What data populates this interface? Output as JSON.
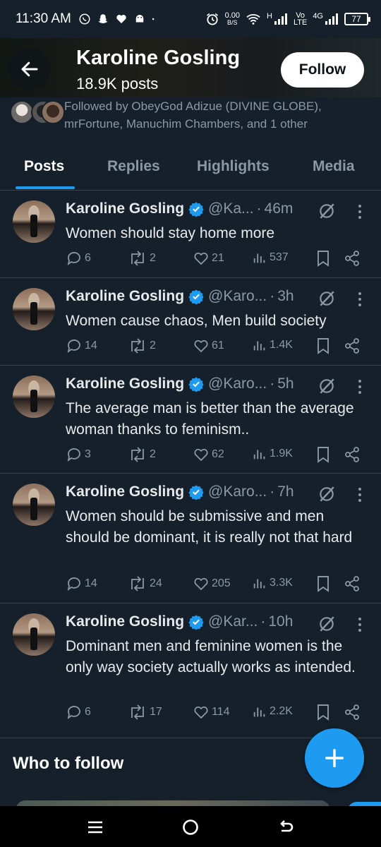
{
  "status_bar": {
    "time": "11:30 AM",
    "net_speed_value": "0.00",
    "net_speed_unit": "B/S",
    "signal1_label": "H",
    "volte_top": "Vo",
    "volte_bottom": "LTE",
    "signal2_label": "4G",
    "battery": "77"
  },
  "header": {
    "title": "Karoline Gosling",
    "posts_count": "18.9K posts",
    "follow_label": "Follow"
  },
  "followed_by": "Followed by ObeyGod Adizue (DIVINE GLOBE), mrFortune, Manuchim Chambers, and 1 other",
  "tabs": [
    "Posts",
    "Replies",
    "Highlights",
    "Media"
  ],
  "posts": [
    {
      "name": "Karoline Gosling",
      "handle": "@Ka...",
      "time": "46m",
      "text": "Women should stay home more",
      "replies": "6",
      "reposts": "2",
      "likes": "21",
      "views": "537"
    },
    {
      "name": "Karoline Gosling",
      "handle": "@Karo...",
      "time": "3h",
      "text": "Women cause chaos, Men build society",
      "replies": "14",
      "reposts": "2",
      "likes": "61",
      "views": "1.4K"
    },
    {
      "name": "Karoline Gosling",
      "handle": "@Karo...",
      "time": "5h",
      "text": "The average man is better than the average woman thanks to feminism..",
      "replies": "3",
      "reposts": "2",
      "likes": "62",
      "views": "1.9K"
    },
    {
      "name": "Karoline Gosling",
      "handle": "@Karo...",
      "time": "7h",
      "text": "Women should be submissive and men should be dominant, it is really not that hard",
      "replies": "14",
      "reposts": "24",
      "likes": "205",
      "views": "3.3K"
    },
    {
      "name": "Karoline Gosling",
      "handle": "@Kar...",
      "time": "10h",
      "text": "Dominant men and feminine women is the only way society actually works as intended.",
      "replies": "6",
      "reposts": "17",
      "likes": "114",
      "views": "2.2K"
    }
  ],
  "who_to_follow": "Who to follow",
  "colors": {
    "background": "#15202b",
    "accent": "#1d9bf0",
    "muted_text": "#8b98a5",
    "divider": "#38444d"
  },
  "icons": {
    "back": "arrow-left-icon",
    "verified": "verified-badge-icon",
    "grok": "grok-slash-icon",
    "more": "more-vertical-icon",
    "reply": "reply-icon",
    "repost": "repost-icon",
    "like": "heart-icon",
    "views": "views-icon",
    "bookmark": "bookmark-icon",
    "share": "share-icon",
    "compose": "plus-icon"
  }
}
